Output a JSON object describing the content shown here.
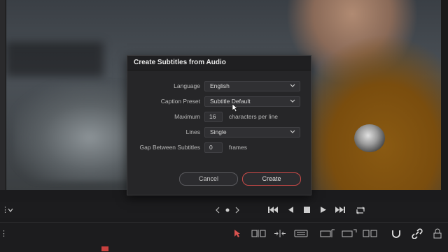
{
  "dialog": {
    "title": "Create Subtitles from Audio",
    "language_label": "Language",
    "language_value": "English",
    "caption_preset_label": "Caption Preset",
    "caption_preset_value": "Subtitle Default",
    "maximum_label": "Maximum",
    "maximum_value": "16",
    "maximum_unit": "characters per line",
    "lines_label": "Lines",
    "lines_value": "Single",
    "gap_label": "Gap Between Subtitles",
    "gap_value": "0",
    "gap_unit": "frames",
    "cancel_label": "Cancel",
    "create_label": "Create"
  },
  "transport": {
    "icons": [
      "view-dropdown-icon",
      "jog-icon",
      "first-frame-icon",
      "prev-frame-icon",
      "stop-icon",
      "play-icon",
      "last-frame-icon",
      "loop-icon"
    ]
  },
  "timeline_toolbar": {
    "icons": [
      "pointer-icon",
      "trim-icon",
      "dynamic-trim-icon",
      "blade-icon",
      "insert-icon",
      "overwrite-icon",
      "replace-icon",
      "snap-icon",
      "link-icon",
      "lock-icon"
    ]
  },
  "colors": {
    "accent_red": "#c94a48",
    "dialog_bg": "#262628",
    "panel_bg": "#1c1c1e"
  }
}
